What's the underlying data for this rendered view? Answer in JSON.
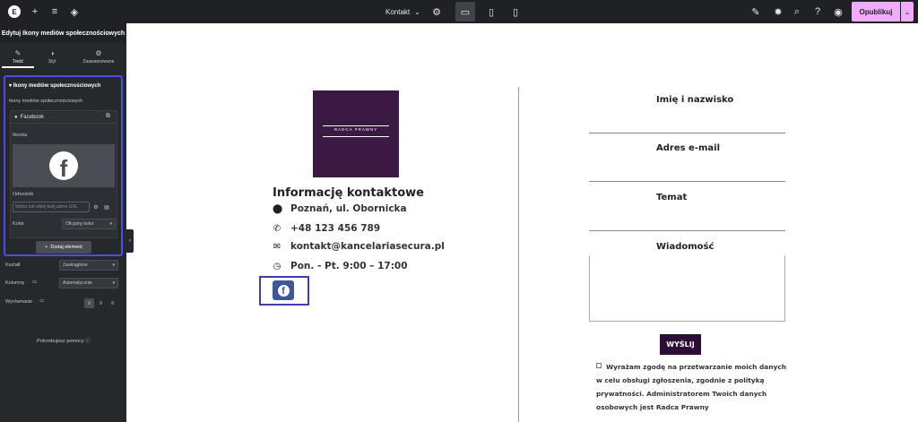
{
  "topbar": {
    "page_name": "Kontakt",
    "publish_label": "Opublikuj"
  },
  "sidebar": {
    "title": "Edytuj Ikony mediów społecznościowych",
    "tabs": [
      {
        "label": "Treść",
        "icon": "pencil-icon"
      },
      {
        "label": "Styl",
        "icon": "half-circle-icon"
      },
      {
        "label": "Zaawansowane",
        "icon": "gear-icon"
      }
    ],
    "section_title": "Ikony mediów społecznościowych",
    "repeater_label": "Ikony mediów społecznościowych",
    "item_label": "Facebook",
    "icon_label": "Ikonka",
    "link_label": "Odnośnik",
    "link_placeholder": "Wpisz lub wklej twój adres URL",
    "color_label": "Kolor",
    "color_value": "Oficjalny kolor",
    "add_button": "Dodaj element",
    "shape_label": "Kształt",
    "shape_value": "Zaokrąglone",
    "columns_label": "Kolumny",
    "columns_value": "Automatycznie",
    "align_label": "Wyrównanie",
    "help_label": "Potrzebujesz pomocy"
  },
  "canvas": {
    "brand": "RADCA PRAWNY",
    "info_title": "Informację kontaktowe",
    "address": "Poznań, ul. Obornicka",
    "phone": "+48 123 456 789",
    "email": "kontakt@kancelariasecura.pl",
    "hours": "Pon. - Pt. 9:00 – 17:00",
    "form": {
      "name_label": "Imię i nazwisko",
      "email_label": "Adres e-mail",
      "subject_label": "Temat",
      "message_label": "Wiadomość",
      "submit": "WYŚLIJ",
      "consent": "Wyrażam zgodę na przetwarzanie moich danych w celu obsługi zgłoszenia, zgodnie z polityką prywatności. Administratorem Twoich danych osobowych jest Radca Prawny"
    }
  },
  "colors": {
    "accent": "#f0abfc",
    "brand_purple": "#3a1942",
    "button_purple": "#2d0d36",
    "facebook": "#3b5998",
    "highlight": "#4a4de6"
  }
}
